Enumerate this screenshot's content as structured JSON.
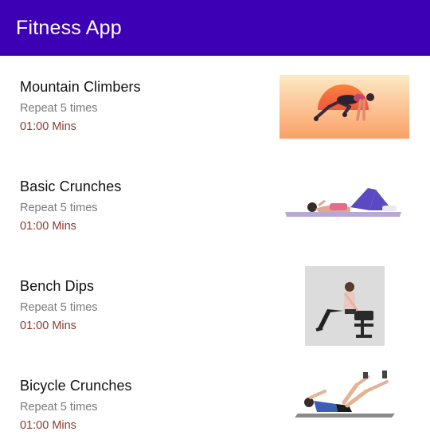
{
  "app_bar": {
    "title": "Fitness App",
    "color": "#3d00b4"
  },
  "exercises": [
    {
      "title": "Mountain Climbers",
      "repeat": "Repeat 5 times",
      "duration": "01:00 Mins",
      "image": "mountain-climbers-illustration"
    },
    {
      "title": "Basic Crunches",
      "repeat": "Repeat 5 times",
      "duration": "01:00 Mins",
      "image": "basic-crunches-illustration"
    },
    {
      "title": "Bench Dips",
      "repeat": "Repeat 5 times",
      "duration": "01:00 Mins",
      "image": "bench-dips-photo"
    },
    {
      "title": "Bicycle Crunches",
      "repeat": "Repeat 5 times",
      "duration": "01:00 Mins",
      "image": "bicycle-crunches-photo"
    }
  ],
  "colors": {
    "title_text": "#111111",
    "repeat_text": "#7a7a7a",
    "duration_text": "#8b3a2e"
  }
}
